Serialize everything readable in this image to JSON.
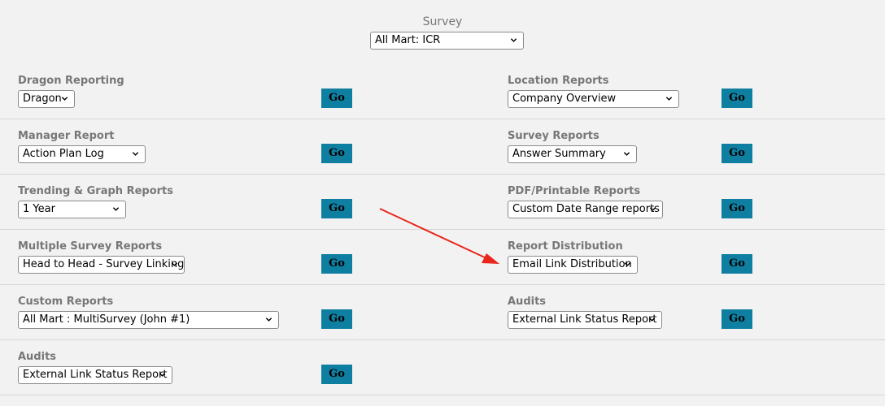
{
  "survey": {
    "title": "Survey",
    "selected": "All Mart: ICR"
  },
  "go_label": "Go",
  "left": [
    {
      "label": "Dragon Reporting",
      "selected": "Dragon"
    },
    {
      "label": "Manager Report",
      "selected": "Action Plan Log"
    },
    {
      "label": "Trending & Graph Reports",
      "selected": "1 Year"
    },
    {
      "label": "Multiple Survey Reports",
      "selected": "Head to Head - Survey Linking"
    },
    {
      "label": "Custom Reports",
      "selected": "All Mart : MultiSurvey (John #1)"
    },
    {
      "label": "Audits",
      "selected": "External Link Status Report"
    }
  ],
  "right": [
    {
      "label": "Location Reports",
      "selected": "Company Overview"
    },
    {
      "label": "Survey Reports",
      "selected": "Answer Summary"
    },
    {
      "label": "PDF/Printable Reports",
      "selected": "Custom Date Range reports"
    },
    {
      "label": "Report Distribution",
      "selected": "Email Link Distribution"
    },
    {
      "label": "Audits",
      "selected": "External Link Status Report"
    }
  ],
  "colors": {
    "background": "#f3f2f2",
    "go_button": "#0e7fa1",
    "label_text": "#777777",
    "annotation_arrow": "#e8261c"
  },
  "icons": {
    "dropdown": "chevron-down-icon",
    "annotation": "red-arrow-annotation"
  }
}
